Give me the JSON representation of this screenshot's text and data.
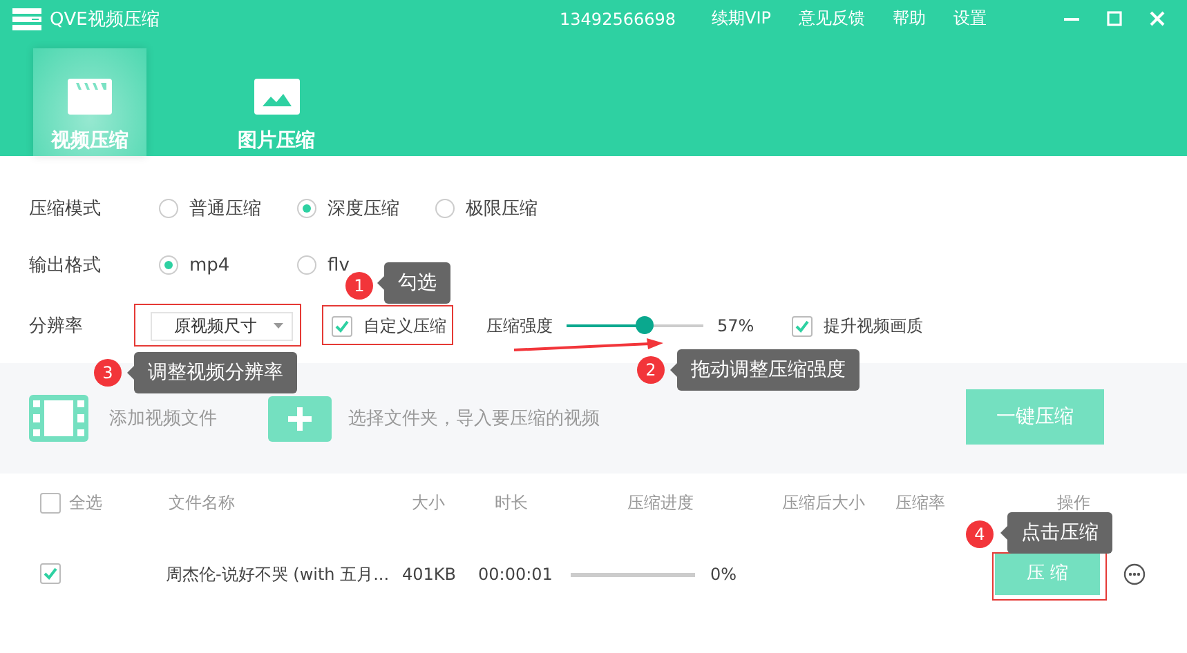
{
  "window": {
    "title": "QVE视频压缩",
    "account": "13492566698",
    "menu": [
      "续期VIP",
      "意见反馈",
      "帮助",
      "设置"
    ]
  },
  "tabs": [
    {
      "label": "视频压缩",
      "selected": true,
      "kind": "video"
    },
    {
      "label": "图片压缩",
      "selected": false,
      "kind": "image"
    }
  ],
  "settings": {
    "compression_mode": {
      "label": "压缩模式",
      "options": [
        {
          "label": "普通压缩",
          "selected": false
        },
        {
          "label": "深度压缩",
          "selected": true
        },
        {
          "label": "极限压缩",
          "selected": false
        }
      ]
    },
    "output_format": {
      "label": "输出格式",
      "options": [
        {
          "label": "mp4",
          "selected": true
        },
        {
          "label": "flv",
          "selected": false
        }
      ]
    },
    "resolution": {
      "label": "分辨率",
      "value": "原视频尺寸",
      "custom": {
        "label": "自定义压缩",
        "checked": true
      },
      "strength": {
        "label": "压缩强度",
        "level": 0.57,
        "reading": "57%"
      },
      "enhance": {
        "label": "提升视频画质",
        "checked": true
      }
    }
  },
  "import_bar": {
    "add_file": "添加视频文件",
    "add_folder": "选择文件夹，导入要压缩的视频",
    "compress_all": "一键压缩"
  },
  "table": {
    "select_all": {
      "label": "全选",
      "checked": false
    },
    "columns": [
      "文件名称",
      "大小",
      "时长",
      "压缩进度",
      "压缩后大小",
      "压缩率",
      "操作"
    ],
    "rows": [
      {
        "checked": true,
        "name": "周杰伦-说好不哭 (with 五月...",
        "size": "401KB",
        "duration": "00:00:01",
        "progress": {
          "level": 0,
          "reading": "0%"
        },
        "action": "压 缩"
      }
    ]
  },
  "annotations": [
    {
      "number": "1",
      "text": "勾选"
    },
    {
      "number": "3",
      "text": "调整视频分辨率"
    },
    {
      "number": "2",
      "text": "拖动调整压缩强度"
    },
    {
      "number": "4",
      "text": "点击压缩"
    }
  ]
}
